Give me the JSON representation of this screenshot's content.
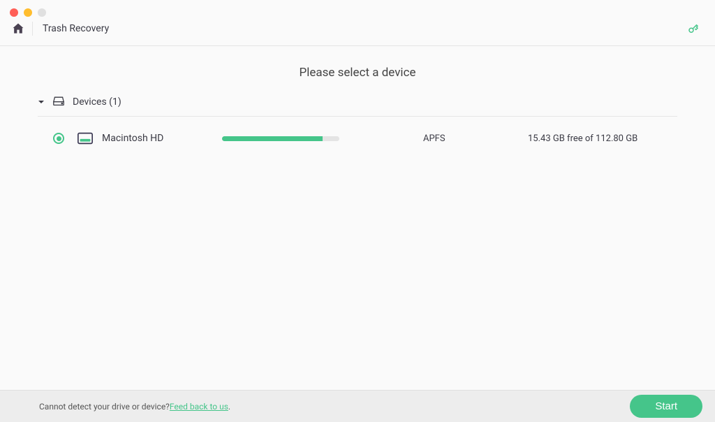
{
  "header": {
    "title": "Trash Recovery"
  },
  "main": {
    "prompt": "Please select a device",
    "section": {
      "label": "Devices (1)"
    },
    "devices": [
      {
        "name": "Macintosh HD",
        "format": "APFS",
        "free_text": "15.43 GB free of 112.80 GB",
        "usage_percent": 86
      }
    ]
  },
  "footer": {
    "detect_text": "Cannot detect your drive or device? ",
    "feedback_link": "Feed back to us",
    "dot": ".",
    "start_label": "Start"
  }
}
